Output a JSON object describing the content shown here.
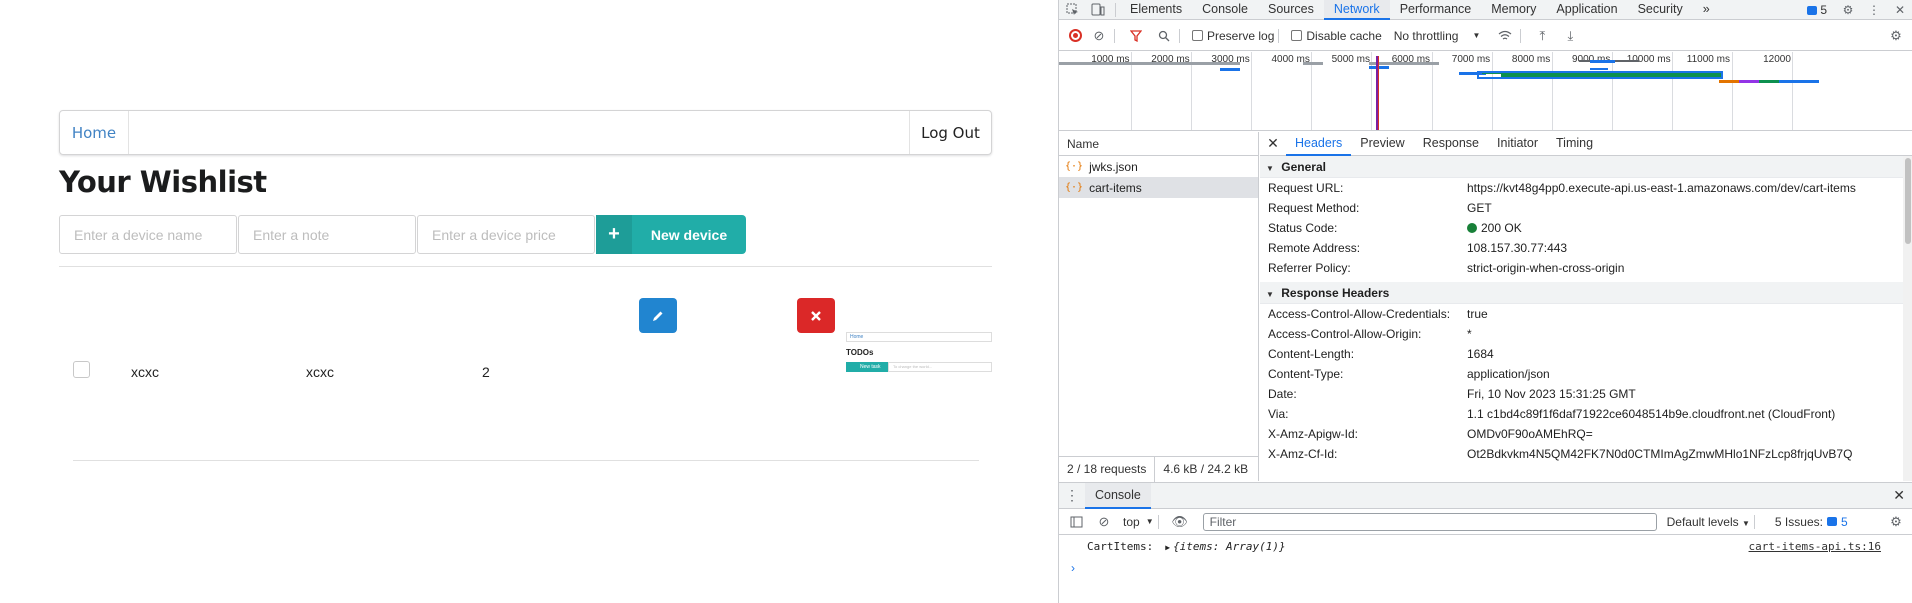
{
  "app": {
    "nav": {
      "home": "Home",
      "logout": "Log Out"
    },
    "title": "Your Wishlist",
    "inputs": {
      "name_placeholder": "Enter a device name",
      "note_placeholder": "Enter a note",
      "price_placeholder": "Enter a device price"
    },
    "new_button": "New device",
    "item": {
      "name": "xcxc",
      "note": "xcxc",
      "price": "2"
    },
    "thumbnail": {
      "nav": "Home",
      "title": "TODOs",
      "button": "New task",
      "input": "To change the world..."
    }
  },
  "devtools": {
    "tabs": [
      "Elements",
      "Console",
      "Sources",
      "Network",
      "Performance",
      "Memory",
      "Application",
      "Security"
    ],
    "active_tab": "Network",
    "more_tabs": "»",
    "issues_count": "5",
    "toolbar": {
      "preserve_log": "Preserve log",
      "disable_cache": "Disable cache",
      "throttling": "No throttling"
    },
    "timeline_labels": [
      "1000 ms",
      "2000 ms",
      "3000 ms",
      "4000 ms",
      "5000 ms",
      "6000 ms",
      "7000 ms",
      "8000 ms",
      "9000 ms",
      "10000 ms",
      "11000 ms",
      "12000"
    ],
    "name_header": "Name",
    "requests": [
      {
        "name": "jwks.json",
        "selected": false
      },
      {
        "name": "cart-items",
        "selected": true
      }
    ],
    "footer": {
      "requests": "2 / 18 requests",
      "size": "4.6 kB / 24.2 kB"
    },
    "detail_tabs": [
      "Headers",
      "Preview",
      "Response",
      "Initiator",
      "Timing"
    ],
    "active_detail_tab": "Headers",
    "general": {
      "title": "General",
      "rows": [
        {
          "k": "Request URL:",
          "v": "https://kvt48g4pp0.execute-api.us-east-1.amazonaws.com/dev/cart-items"
        },
        {
          "k": "Request Method:",
          "v": "GET"
        },
        {
          "k": "Status Code:",
          "v": "200 OK"
        },
        {
          "k": "Remote Address:",
          "v": "108.157.30.77:443"
        },
        {
          "k": "Referrer Policy:",
          "v": "strict-origin-when-cross-origin"
        }
      ]
    },
    "response_headers": {
      "title": "Response Headers",
      "rows": [
        {
          "k": "Access-Control-Allow-Credentials:",
          "v": "true"
        },
        {
          "k": "Access-Control-Allow-Origin:",
          "v": "*"
        },
        {
          "k": "Content-Length:",
          "v": "1684"
        },
        {
          "k": "Content-Type:",
          "v": "application/json"
        },
        {
          "k": "Date:",
          "v": "Fri, 10 Nov 2023 15:31:25 GMT"
        },
        {
          "k": "Via:",
          "v": "1.1 c1bd4c89f1f6daf71922ce6048514b9e.cloudfront.net (CloudFront)"
        },
        {
          "k": "X-Amz-Apigw-Id:",
          "v": "OMDv0F90oAMEhRQ="
        },
        {
          "k": "X-Amz-Cf-Id:",
          "v": "Ot2Bdkvkm4N5QM42FK7N0d0CTMImAgZmwMHlo1NFzLcp8frjqUvB7Q"
        }
      ]
    },
    "console": {
      "tab": "Console",
      "context": "top",
      "filter_placeholder": "Filter",
      "levels": "Default levels",
      "issues": "5 Issues:",
      "issues_n": "5",
      "log_label": "CartItems:",
      "log_obj": "{items: Array(1)}",
      "log_src": "cart-items-api.ts:16",
      "prompt": "›"
    },
    "colors": {
      "accent": "#1a73e8",
      "teal": "#21ada8",
      "edit": "#2185d0",
      "delete": "#db2828"
    }
  }
}
